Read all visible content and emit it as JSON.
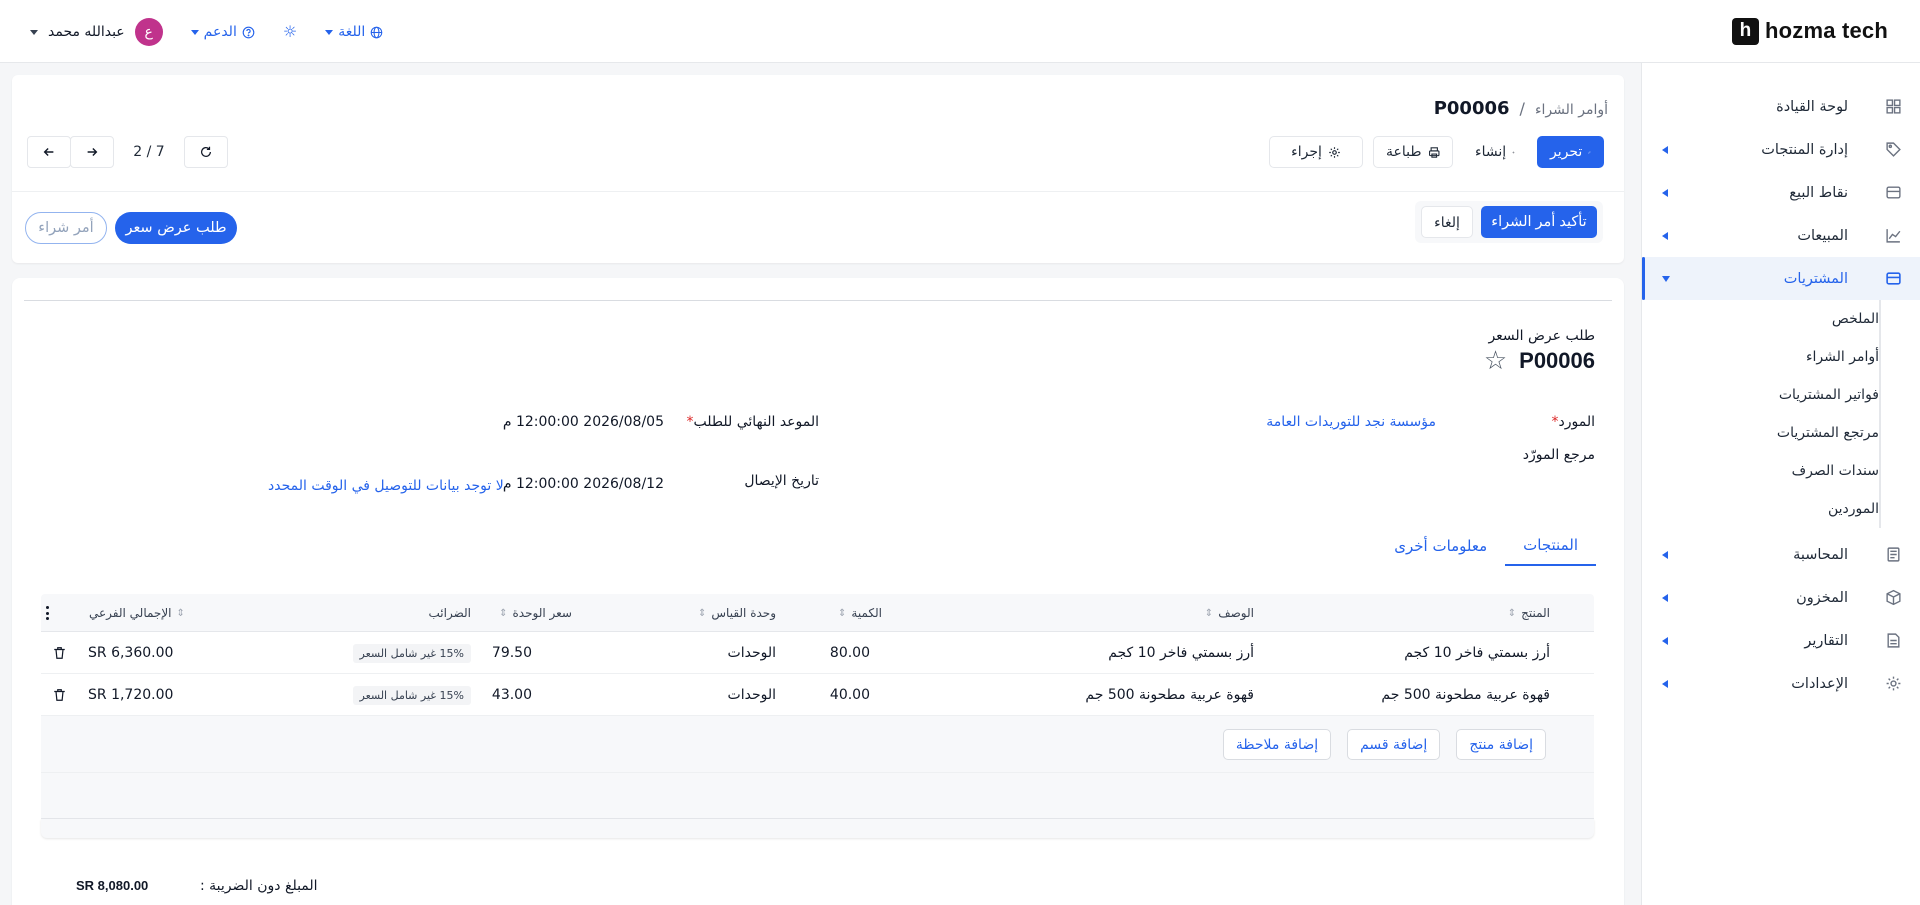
{
  "brand": {
    "logo_letter": "h",
    "logo_text": "hozma tech"
  },
  "topbar": {
    "username": "عبدالله محمد",
    "avatar_letter": "ع",
    "support_label": "الدعم",
    "language_label": "اللغة"
  },
  "sidebar": {
    "items": [
      {
        "label": "لوحة القيادة",
        "icon": "grid-icon"
      },
      {
        "label": "إدارة المنتجات",
        "icon": "tag-icon"
      },
      {
        "label": "نقاط البيع",
        "icon": "store-icon"
      },
      {
        "label": "المبيعات",
        "icon": "chart-icon"
      },
      {
        "label": "المشتريات",
        "icon": "card-icon"
      },
      {
        "label": "المحاسبة",
        "icon": "ledger-icon"
      },
      {
        "label": "المخزون",
        "icon": "box-icon"
      },
      {
        "label": "التقارير",
        "icon": "report-icon"
      },
      {
        "label": "الإعدادات",
        "icon": "gear-icon"
      }
    ],
    "purchases_subitems": [
      "الملخص",
      "أوامر الشراء",
      "فواتير المشتريات",
      "مرتجع المشتريات",
      "سندات الصرف",
      "الموردين"
    ]
  },
  "header": {
    "breadcrumb_parent": "أوامر الشراء",
    "breadcrumb_sep": "/",
    "breadcrumb_current": "P00006",
    "edit_label": "تحرير",
    "create_label": "إنشاء",
    "print_label": "طباعة",
    "action_label": "إجراء",
    "pager_count": "2 / 7",
    "confirm_label": "تأكيد أمر الشراء",
    "cancel_label": "إلغاء",
    "stage_rfq": "طلب عرض سعر",
    "stage_po": "أمر شراء"
  },
  "document": {
    "type_label": "طلب عرض السعر",
    "number": "P00006",
    "supplier_label": "المورد",
    "supplier_value": "مؤسسة نجد للتوريدات العامة",
    "supplier_ref_label": "مرجع المورّد",
    "deadline_label": "الموعد النهائي للطلب",
    "deadline_value": "2026/08/05 12:00:00 م",
    "delivery_label": "تاريخ الإيصال",
    "delivery_value": "2026/08/12 12:00:00 م",
    "on_time_link": "لا توجد بيانات للتوصيل في الوقت المحدد"
  },
  "tabs": {
    "products": "المنتجات",
    "other_info": "معلومات أخرى"
  },
  "table": {
    "headers": {
      "product": "المنتج",
      "description": "الوصف",
      "quantity": "الكمية",
      "uom": "وحدة القياس",
      "unit_price": "سعر الوحدة",
      "taxes": "الضرائب",
      "subtotal": "الإجمالي الفرعي"
    },
    "rows": [
      {
        "product": "أرز بسمتي فاخر 10 كجم",
        "description": "أرز بسمتي فاخر 10 كجم",
        "quantity": "80.00",
        "uom": "الوحدات",
        "unit_price": "79.50",
        "tax": "15% غير شامل السعر",
        "subtotal": "SR 6,360.00"
      },
      {
        "product": "قهوة عربية مطحونة 500 جم",
        "description": "قهوة عربية مطحونة 500 جم",
        "quantity": "40.00",
        "uom": "الوحدات",
        "unit_price": "43.00",
        "tax": "15% غير شامل السعر",
        "subtotal": "SR 1,720.00"
      }
    ],
    "add_product": "إضافة منتج",
    "add_section": "إضافة قسم",
    "add_note": "إضافة ملاحظة"
  },
  "totals": {
    "untaxed_label": "المبلغ دون الضريبة :",
    "untaxed_value": "SR 8,080.00"
  },
  "colors": {
    "primary": "#2563eb",
    "avatar": "#c0338c",
    "required": "#dc2626"
  }
}
